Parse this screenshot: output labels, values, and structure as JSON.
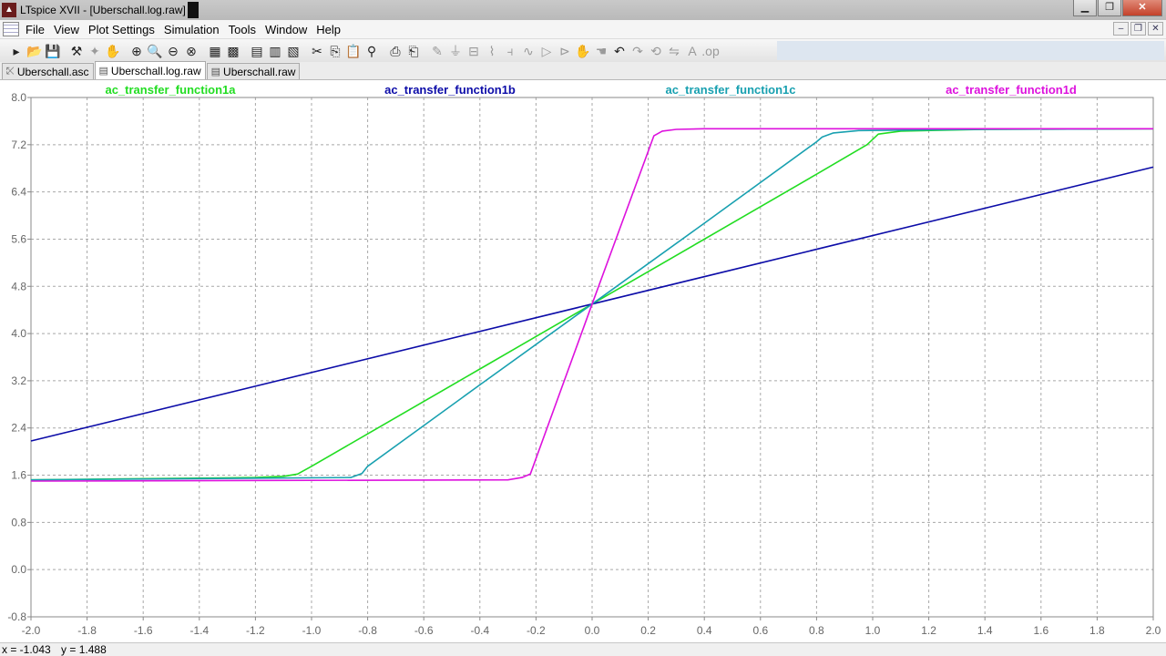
{
  "window": {
    "title": "LTspice XVII - [Uberschall.log.raw]"
  },
  "menu": [
    "File",
    "View",
    "Plot Settings",
    "Simulation",
    "Tools",
    "Window",
    "Help"
  ],
  "tabs": [
    {
      "label": "Uberschall.asc",
      "icon": "schematic-icon",
      "active": false
    },
    {
      "label": "Uberschall.log.raw",
      "icon": "waveform-icon",
      "active": true
    },
    {
      "label": "Uberschall.raw",
      "icon": "waveform-icon",
      "active": false
    }
  ],
  "status": {
    "x_readout": "x = -1.043",
    "y_readout": "y = 1.488"
  },
  "chart_data": {
    "type": "line",
    "title": "",
    "xlabel": "",
    "ylabel": "",
    "xlim": [
      -2.0,
      2.0
    ],
    "ylim": [
      -0.8,
      8.0
    ],
    "x_ticks": [
      "-2.0",
      "-1.8",
      "-1.6",
      "-1.4",
      "-1.2",
      "-1.0",
      "-0.8",
      "-0.6",
      "-0.4",
      "-0.2",
      "0.0",
      "0.2",
      "0.4",
      "0.6",
      "0.8",
      "1.0",
      "1.2",
      "1.4",
      "1.6",
      "1.8",
      "2.0"
    ],
    "y_ticks": [
      "8.0",
      "7.2",
      "6.4",
      "5.6",
      "4.8",
      "4.0",
      "3.2",
      "2.4",
      "1.6",
      "0.8",
      "0.0",
      "-0.8"
    ],
    "grid": true,
    "legend_position": "top",
    "series": [
      {
        "name": "ac_transfer_function1a",
        "color": "#22dd22",
        "x": [
          -2.0,
          -1.2,
          -1.1,
          -1.05,
          -1.0,
          -0.8,
          -0.4,
          0.0,
          0.4,
          0.8,
          0.98,
          1.02,
          1.1,
          1.4,
          2.0
        ],
        "y": [
          1.52,
          1.56,
          1.58,
          1.62,
          1.75,
          2.3,
          3.4,
          4.5,
          5.6,
          6.7,
          7.2,
          7.38,
          7.43,
          7.46,
          7.47
        ]
      },
      {
        "name": "ac_transfer_function1b",
        "color": "#0c0ca8",
        "x": [
          -2.0,
          0.0,
          2.0
        ],
        "y": [
          2.18,
          4.5,
          6.82
        ]
      },
      {
        "name": "ac_transfer_function1c",
        "color": "#18a0b0",
        "x": [
          -2.0,
          -0.86,
          -0.82,
          -0.8,
          -0.4,
          0.0,
          0.4,
          0.8,
          0.82,
          0.86,
          0.95,
          1.4,
          2.0
        ],
        "y": [
          1.52,
          1.56,
          1.63,
          1.75,
          3.13,
          4.5,
          5.87,
          7.25,
          7.33,
          7.4,
          7.44,
          7.46,
          7.47
        ]
      },
      {
        "name": "ac_transfer_function1d",
        "color": "#dd11dd",
        "x": [
          -2.0,
          -0.3,
          -0.25,
          -0.22,
          0.0,
          0.22,
          0.25,
          0.3,
          0.4,
          2.0
        ],
        "y": [
          1.5,
          1.52,
          1.56,
          1.62,
          4.5,
          7.35,
          7.43,
          7.46,
          7.47,
          7.47
        ]
      }
    ]
  }
}
